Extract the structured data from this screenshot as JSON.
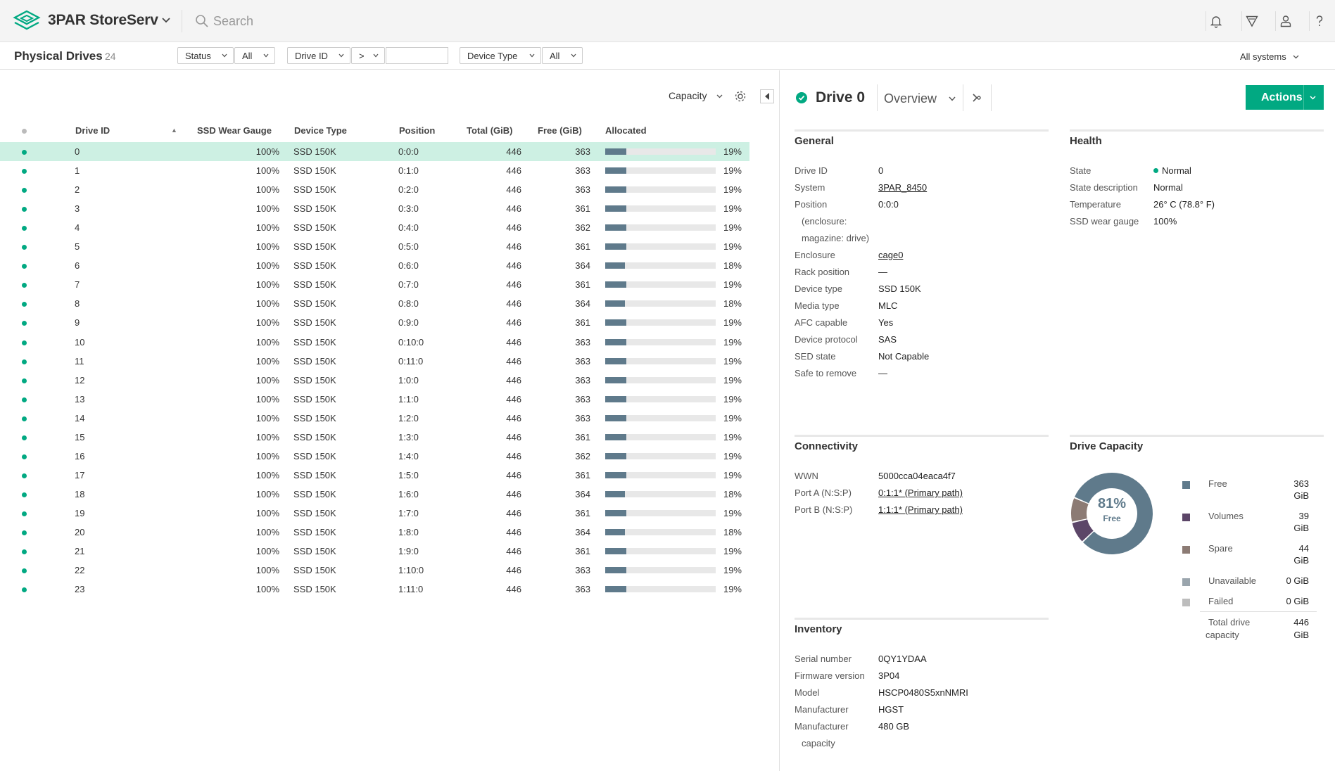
{
  "header": {
    "app_title": "3PAR StoreServ",
    "search_placeholder": "Search"
  },
  "filterbar": {
    "title": "Physical Drives",
    "count": "24",
    "status_label": "Status",
    "status_value": "All",
    "driveid_label": "Drive ID",
    "driveid_op": ">",
    "driveid_value": "",
    "devtype_label": "Device Type",
    "devtype_value": "All",
    "systems": "All systems"
  },
  "list": {
    "view": "Capacity",
    "columns": [
      "Drive ID",
      "SSD Wear Gauge",
      "Device Type",
      "Position",
      "Total (GiB)",
      "Free (GiB)",
      "Allocated"
    ],
    "rows": [
      {
        "id": "0",
        "wear": "100%",
        "type": "SSD 150K",
        "pos": "0:0:0",
        "total": "446",
        "free": "363",
        "alloc": "19%"
      },
      {
        "id": "1",
        "wear": "100%",
        "type": "SSD 150K",
        "pos": "0:1:0",
        "total": "446",
        "free": "363",
        "alloc": "19%"
      },
      {
        "id": "2",
        "wear": "100%",
        "type": "SSD 150K",
        "pos": "0:2:0",
        "total": "446",
        "free": "363",
        "alloc": "19%"
      },
      {
        "id": "3",
        "wear": "100%",
        "type": "SSD 150K",
        "pos": "0:3:0",
        "total": "446",
        "free": "361",
        "alloc": "19%"
      },
      {
        "id": "4",
        "wear": "100%",
        "type": "SSD 150K",
        "pos": "0:4:0",
        "total": "446",
        "free": "362",
        "alloc": "19%"
      },
      {
        "id": "5",
        "wear": "100%",
        "type": "SSD 150K",
        "pos": "0:5:0",
        "total": "446",
        "free": "361",
        "alloc": "19%"
      },
      {
        "id": "6",
        "wear": "100%",
        "type": "SSD 150K",
        "pos": "0:6:0",
        "total": "446",
        "free": "364",
        "alloc": "18%"
      },
      {
        "id": "7",
        "wear": "100%",
        "type": "SSD 150K",
        "pos": "0:7:0",
        "total": "446",
        "free": "361",
        "alloc": "19%"
      },
      {
        "id": "8",
        "wear": "100%",
        "type": "SSD 150K",
        "pos": "0:8:0",
        "total": "446",
        "free": "364",
        "alloc": "18%"
      },
      {
        "id": "9",
        "wear": "100%",
        "type": "SSD 150K",
        "pos": "0:9:0",
        "total": "446",
        "free": "361",
        "alloc": "19%"
      },
      {
        "id": "10",
        "wear": "100%",
        "type": "SSD 150K",
        "pos": "0:10:0",
        "total": "446",
        "free": "363",
        "alloc": "19%"
      },
      {
        "id": "11",
        "wear": "100%",
        "type": "SSD 150K",
        "pos": "0:11:0",
        "total": "446",
        "free": "363",
        "alloc": "19%"
      },
      {
        "id": "12",
        "wear": "100%",
        "type": "SSD 150K",
        "pos": "1:0:0",
        "total": "446",
        "free": "363",
        "alloc": "19%"
      },
      {
        "id": "13",
        "wear": "100%",
        "type": "SSD 150K",
        "pos": "1:1:0",
        "total": "446",
        "free": "363",
        "alloc": "19%"
      },
      {
        "id": "14",
        "wear": "100%",
        "type": "SSD 150K",
        "pos": "1:2:0",
        "total": "446",
        "free": "363",
        "alloc": "19%"
      },
      {
        "id": "15",
        "wear": "100%",
        "type": "SSD 150K",
        "pos": "1:3:0",
        "total": "446",
        "free": "361",
        "alloc": "19%"
      },
      {
        "id": "16",
        "wear": "100%",
        "type": "SSD 150K",
        "pos": "1:4:0",
        "total": "446",
        "free": "362",
        "alloc": "19%"
      },
      {
        "id": "17",
        "wear": "100%",
        "type": "SSD 150K",
        "pos": "1:5:0",
        "total": "446",
        "free": "361",
        "alloc": "19%"
      },
      {
        "id": "18",
        "wear": "100%",
        "type": "SSD 150K",
        "pos": "1:6:0",
        "total": "446",
        "free": "364",
        "alloc": "18%"
      },
      {
        "id": "19",
        "wear": "100%",
        "type": "SSD 150K",
        "pos": "1:7:0",
        "total": "446",
        "free": "361",
        "alloc": "19%"
      },
      {
        "id": "20",
        "wear": "100%",
        "type": "SSD 150K",
        "pos": "1:8:0",
        "total": "446",
        "free": "364",
        "alloc": "18%"
      },
      {
        "id": "21",
        "wear": "100%",
        "type": "SSD 150K",
        "pos": "1:9:0",
        "total": "446",
        "free": "361",
        "alloc": "19%"
      },
      {
        "id": "22",
        "wear": "100%",
        "type": "SSD 150K",
        "pos": "1:10:0",
        "total": "446",
        "free": "363",
        "alloc": "19%"
      },
      {
        "id": "23",
        "wear": "100%",
        "type": "SSD 150K",
        "pos": "1:11:0",
        "total": "446",
        "free": "363",
        "alloc": "19%"
      }
    ]
  },
  "detail": {
    "title": "Drive 0",
    "view": "Overview",
    "actions": "Actions",
    "general": {
      "heading": "General",
      "items": [
        {
          "k": "Drive ID",
          "v": "0"
        },
        {
          "k": "System",
          "v": "3PAR_8450",
          "link": true
        },
        {
          "k": "Position",
          "v": "0:0:0"
        },
        {
          "k": "(enclosure:",
          "v": ""
        },
        {
          "k": "magazine: drive)",
          "v": ""
        },
        {
          "k": "Enclosure",
          "v": "cage0",
          "link": true
        },
        {
          "k": "Rack position",
          "v": "—"
        },
        {
          "k": "Device type",
          "v": "SSD 150K"
        },
        {
          "k": "Media type",
          "v": "MLC"
        },
        {
          "k": "AFC capable",
          "v": "Yes"
        },
        {
          "k": "Device protocol",
          "v": "SAS"
        },
        {
          "k": "SED state",
          "v": "Not Capable"
        },
        {
          "k": "Safe to remove",
          "v": "—"
        }
      ]
    },
    "health": {
      "heading": "Health",
      "items": [
        {
          "k": "State",
          "v": "Normal"
        },
        {
          "k": "State description",
          "v": "Normal"
        },
        {
          "k": "Temperature",
          "v": "26° C (78.8° F)"
        },
        {
          "k": "SSD wear gauge",
          "v": "100%"
        }
      ]
    },
    "connectivity": {
      "heading": "Connectivity",
      "items": [
        {
          "k": "WWN",
          "v": "5000cca04eaca4f7"
        },
        {
          "k": "Port A (N:S:P)",
          "v": "0:1:1* (Primary path)",
          "link": true
        },
        {
          "k": "Port B (N:S:P)",
          "v": "1:1:1* (Primary path)",
          "link": true
        }
      ]
    },
    "inventory": {
      "heading": "Inventory",
      "items": [
        {
          "k": "Serial number",
          "v": "0QY1YDAA"
        },
        {
          "k": "Firmware version",
          "v": "3P04"
        },
        {
          "k": "Model",
          "v": "HSCP0480S5xnNMRI"
        },
        {
          "k": "Manufacturer",
          "v": "HGST"
        },
        {
          "k": "Manufacturer",
          "v": "480 GB"
        },
        {
          "k": "capacity",
          "v": ""
        }
      ]
    },
    "capacity": {
      "heading": "Drive Capacity",
      "donut_pct": "81%",
      "donut_label": "Free",
      "legend": [
        {
          "label": "Free",
          "value": "363",
          "unit": "GiB",
          "color": "#5f7a8b",
          "gib": 363
        },
        {
          "label": "Volumes",
          "value": "39",
          "unit": "GiB",
          "color": "#5c4668",
          "gib": 39
        },
        {
          "label": "Spare",
          "value": "44",
          "unit": "GiB",
          "color": "#8c7b74",
          "gib": 44
        },
        {
          "label": "Unavailable",
          "value": "0 GiB",
          "unit": "",
          "color": "#9aa5ad",
          "gib": 0
        },
        {
          "label": "Failed",
          "value": "0 GiB",
          "unit": "",
          "color": "#bdbdbd",
          "gib": 0
        }
      ],
      "total_label_1": "Total drive",
      "total_label_2": "capacity",
      "total_value": "446",
      "total_unit": "GiB"
    }
  }
}
